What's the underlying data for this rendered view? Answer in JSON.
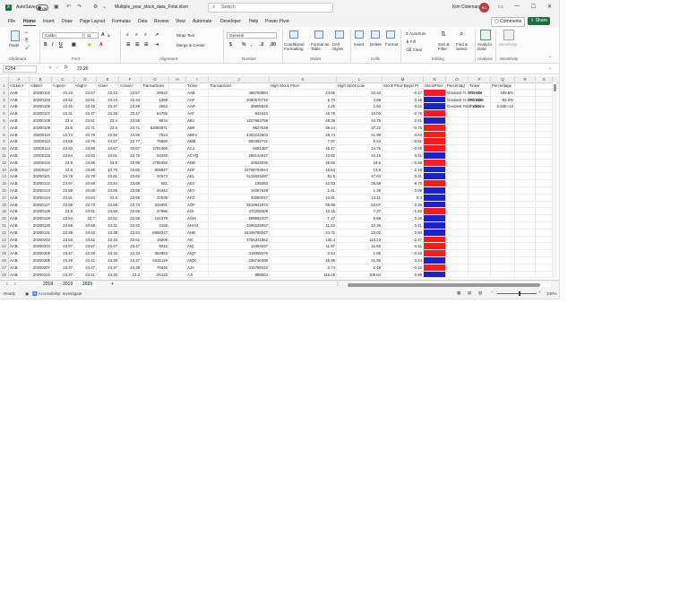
{
  "titlebar": {
    "logo": "X",
    "autosave_label": "AutoSave",
    "autosave_state": "Off",
    "filename": "Multiple_year_stock_data_Final.xlsm",
    "search_placeholder": "Search",
    "user_name": "Kim Coleman",
    "user_initials": "KC"
  },
  "menu": {
    "tabs": [
      "File",
      "Home",
      "Insert",
      "Draw",
      "Page Layout",
      "Formulas",
      "Data",
      "Review",
      "View",
      "Automate",
      "Developer",
      "Help",
      "Power Pivot"
    ],
    "active": "Home",
    "comments_label": "Comments",
    "share_label": "Share"
  },
  "ribbon": {
    "paste_label": "Paste",
    "font_name": "Calibri",
    "font_size": "11",
    "wrap_text": "Wrap Text",
    "merge_center": "Merge & Center",
    "number_format": "General",
    "conditional_formatting": "Conditional Formatting",
    "format_as_table": "Format as Table",
    "cell_styles": "Cell Styles",
    "insert": "Insert",
    "delete": "Delete",
    "format": "Format",
    "autosum": "AutoSum",
    "fill": "Fill",
    "clear": "Clear",
    "sort_filter": "Sort & Filter",
    "find_select": "Find & Select",
    "analyze_data": "Analyze Data",
    "sensitivity": "Sensitivity",
    "groups": [
      "Clipboard",
      "Font",
      "Alignment",
      "Number",
      "Styles",
      "Cells",
      "Editing",
      "Analysis",
      "Sensitivity"
    ]
  },
  "formula_bar": {
    "name_box": "F254",
    "fx": "fx",
    "value": "23.26"
  },
  "columns": [
    "A",
    "B",
    "C",
    "D",
    "E",
    "F",
    "G",
    "H",
    "I",
    "J",
    "K",
    "L",
    "M",
    "N",
    "O",
    "P",
    "Q",
    "R",
    "S"
  ],
  "headers": {
    "A": "<ticker>",
    "B": "<date>",
    "C": "<open>",
    "D": "<high>",
    "E": "<low>",
    "F": "<close>",
    "G": "Transactions",
    "I": "Ticker",
    "J": "Transactions",
    "K": "High Stock Price",
    "L": "High Stock Low",
    "M": "Stock Price Begin Pr",
    "N": "StockPrice",
    "O": "Percentag",
    "P": "Ticker",
    "Q": "Percentage"
  },
  "rows": [
    {
      "A": "AAB",
      "B": "20200102",
      "C": "23.43",
      "D": "23.57",
      "E": "23.43",
      "F": "23.57",
      "G": "28522",
      "I": "AAB",
      "J": "455750984",
      "K": "24.96",
      "L": "22.34",
      "M": "-0.17",
      "N": "neg",
      "O": "Greatest % Increase",
      "P": "PS YDI",
      "Q": "188.8%"
    },
    {
      "A": "AAB",
      "B": "20200103",
      "C": "23.52",
      "D": "23.61",
      "E": "23.43",
      "F": "23.44",
      "G": "1399",
      "I": "AAF",
      "J": "2080570716",
      "K": "5.73",
      "L": "4.88",
      "M": "0.18",
      "N": "pos",
      "O": "Greatest % Decrease",
      "P": "PS ZZK",
      "Q": "-89.0%"
    },
    {
      "A": "AAB",
      "B": "20200106",
      "C": "23.46",
      "D": "23.48",
      "E": "23.37",
      "F": "23.39",
      "G": "2953",
      "I": "AAR",
      "J": "39905528",
      "K": "2.25",
      "L": "1.83",
      "M": "0.42",
      "N": "pos",
      "O": "Greatest Total Volume",
      "P": "T GKN",
      "Q": "3.45E+12"
    },
    {
      "A": "AAB",
      "B": "20200107",
      "C": "23.31",
      "D": "23.47",
      "E": "23.28",
      "F": "23.47",
      "G": "64755",
      "I": "AAT",
      "J": "843410",
      "K": "15.78",
      "L": "10.03",
      "M": "-2.76",
      "N": "neg"
    },
    {
      "A": "AAB",
      "B": "20200108",
      "C": "23.4",
      "D": "23.61",
      "E": "23.4",
      "F": "23.58",
      "G": "8534",
      "I": "ABJ",
      "J": "1227953758",
      "K": "48.35",
      "L": "44.75",
      "M": "2.41",
      "N": "pos"
    },
    {
      "A": "AAB",
      "B": "20200109",
      "C": "23.6",
      "D": "23.71",
      "E": "23.6",
      "F": "23.71",
      "G": "62083971",
      "I": "ABK",
      "J": "9527549",
      "K": "39.14",
      "L": "37.22",
      "M": "-0.75",
      "N": "neg"
    },
    {
      "A": "AAB",
      "B": "20200110",
      "C": "23.74",
      "D": "23.76",
      "E": "23.52",
      "F": "23.55",
      "G": "7524",
      "I": "ABKV",
      "J": "4402222603",
      "K": "28.74",
      "L": "21.99",
      "M": "-3.53",
      "N": "neg"
    },
    {
      "A": "AAB",
      "B": "20200113",
      "C": "23.58",
      "D": "23.79",
      "E": "23.57",
      "F": "23.77",
      "G": "76550",
      "I": "ABM",
      "J": "593492721",
      "K": "7.97",
      "L": "6.63",
      "M": "-0.91",
      "N": "neg"
    },
    {
      "A": "AAB",
      "B": "20200114",
      "C": "23.83",
      "D": "23.88",
      "E": "23.67",
      "F": "23.67",
      "G": "3781390",
      "I": "ACJ",
      "J": "6081487",
      "K": "15.47",
      "L": "14.75",
      "M": "-0.45",
      "N": "neg"
    },
    {
      "A": "AAB",
      "B": "20200115",
      "C": "23.64",
      "D": "23.83",
      "E": "23.61",
      "F": "23.76",
      "G": "53283",
      "I": "ACYQ",
      "J": "285144917",
      "K": "43.82",
      "L": "42.15",
      "M": "0.31",
      "N": "pos"
    },
    {
      "A": "AAB",
      "B": "20200116",
      "C": "23.8",
      "D": "23.98",
      "E": "23.8",
      "F": "23.98",
      "G": "2796350",
      "I": "ADB",
      "J": "34526036",
      "K": "25.66",
      "L": "24.6",
      "M": "-0.68",
      "N": "neg"
    },
    {
      "A": "AAB",
      "B": "20200117",
      "C": "23.9",
      "D": "23.95",
      "E": "23.79",
      "F": "23.82",
      "G": "809847",
      "I": "ADF",
      "J": "22708794844",
      "K": "16.64",
      "L": "13.9",
      "M": "2.18",
      "N": "pos"
    },
    {
      "A": "AAB",
      "B": "20200121",
      "C": "23.78",
      "D": "23.78",
      "E": "23.61",
      "F": "23.65",
      "G": "37674",
      "I": "AEL",
      "J": "5115026297",
      "K": "51.6",
      "L": "47.04",
      "M": "3.31",
      "N": "pos"
    },
    {
      "A": "AAB",
      "B": "20200122",
      "C": "23.67",
      "D": "23.68",
      "E": "23.54",
      "F": "23.68",
      "G": "681",
      "I": "AEV",
      "J": "196083",
      "K": "42.93",
      "L": "28.58",
      "M": "-8.75",
      "N": "neg"
    },
    {
      "A": "AAB",
      "B": "20200123",
      "C": "23.59",
      "D": "23.68",
      "E": "23.56",
      "F": "23.58",
      "G": "34342",
      "I": "AEY",
      "J": "14067649",
      "K": "1.61",
      "L": "1.35",
      "M": "0.08",
      "N": "pos"
    },
    {
      "A": "AAB",
      "B": "20200124",
      "C": "23.51",
      "D": "23.62",
      "E": "23.5",
      "F": "23.59",
      "G": "37839",
      "I": "AFZ",
      "J": "33093017",
      "K": "13.81",
      "L": "13.11",
      "M": "0.3",
      "N": "pos"
    },
    {
      "A": "AAB",
      "B": "20200127",
      "C": "23.58",
      "D": "23.73",
      "E": "23.58",
      "F": "23.73",
      "G": "315691",
      "I": "AGF",
      "J": "2618841972",
      "K": "55.88",
      "L": "53.07",
      "M": "0.25",
      "N": "pos"
    },
    {
      "A": "AAB",
      "B": "20200128",
      "C": "23.8",
      "D": "23.81",
      "E": "23.65",
      "F": "23.65",
      "G": "37896",
      "I": "AGI",
      "J": "470205509",
      "K": "10.15",
      "L": "7.37",
      "M": "-1.83",
      "N": "neg"
    },
    {
      "A": "AAB",
      "B": "20200129",
      "C": "23.64",
      "D": "23.7",
      "E": "23.51",
      "F": "23.59",
      "G": "122379",
      "I": "AGM",
      "J": "289582207",
      "K": "7.17",
      "L": "6.59",
      "M": "0.26",
      "N": "pos"
    },
    {
      "A": "AAB",
      "B": "20200130",
      "C": "23.58",
      "D": "23.58",
      "E": "23.31",
      "F": "23.32",
      "G": "2156",
      "I": "AHAO",
      "J": "3406228557",
      "K": "11.22",
      "L": "10.36",
      "M": "0.21",
      "N": "pos"
    },
    {
      "A": "AAB",
      "B": "20200131",
      "C": "23.38",
      "D": "23.53",
      "E": "23.38",
      "F": "23.53",
      "G": "6958347",
      "I": "AHB",
      "J": "24449788347",
      "K": "24.72",
      "L": "23.02",
      "M": "0.94",
      "N": "pos"
    },
    {
      "A": "AAB",
      "B": "20200203",
      "C": "23.53",
      "D": "23.62",
      "E": "23.46",
      "F": "23.62",
      "G": "19206",
      "I": "AIC",
      "J": "3756341852",
      "K": "130.4",
      "L": "115.23",
      "M": "-2.47",
      "N": "neg"
    },
    {
      "A": "AAB",
      "B": "20200204",
      "C": "23.67",
      "D": "23.67",
      "E": "23.47",
      "F": "23.47",
      "G": "5012",
      "I": "AIQ",
      "J": "12394637",
      "K": "11.87",
      "L": "11.56",
      "M": "-0.11",
      "N": "neg"
    },
    {
      "A": "AAB",
      "B": "20200205",
      "C": "23.47",
      "D": "23.49",
      "E": "23.32",
      "F": "23.33",
      "G": "353963",
      "I": "AIQF",
      "J": "319058376",
      "K": "2.54",
      "L": "1.95",
      "M": "-0.46",
      "N": "neg"
    },
    {
      "A": "AAB",
      "B": "20200206",
      "C": "23.29",
      "D": "23.41",
      "E": "23.29",
      "F": "23.37",
      "G": "6415149",
      "I": "AIQK",
      "J": "236740388",
      "K": "26.95",
      "L": "21.95",
      "M": "3.44",
      "N": "pos"
    },
    {
      "A": "AAB",
      "B": "20200207",
      "C": "23.37",
      "D": "23.47",
      "E": "23.37",
      "F": "23.38",
      "G": "70645",
      "I": "AJA",
      "J": "310788310",
      "K": "2.74",
      "L": "2.48",
      "M": "-0.12",
      "N": "neg"
    },
    {
      "A": "AAB",
      "B": "20200210",
      "C": "23.37",
      "D": "23.41",
      "E": "23.26",
      "F": "23.3",
      "G": "26125",
      "I": "AJI",
      "J": "898554",
      "K": "115.25",
      "L": "109.84",
      "M": "0.88",
      "N": "pos"
    }
  ],
  "sheets": [
    "2018",
    "2019",
    "2020"
  ],
  "active_sheet": "2020",
  "status": {
    "ready": "Ready",
    "accessibility": "Accessibility: Investigate",
    "zoom": "100%"
  },
  "colors": {
    "negative": "#ff1a1a",
    "positive": "#1a22cc",
    "brand": "#1d6f42"
  }
}
